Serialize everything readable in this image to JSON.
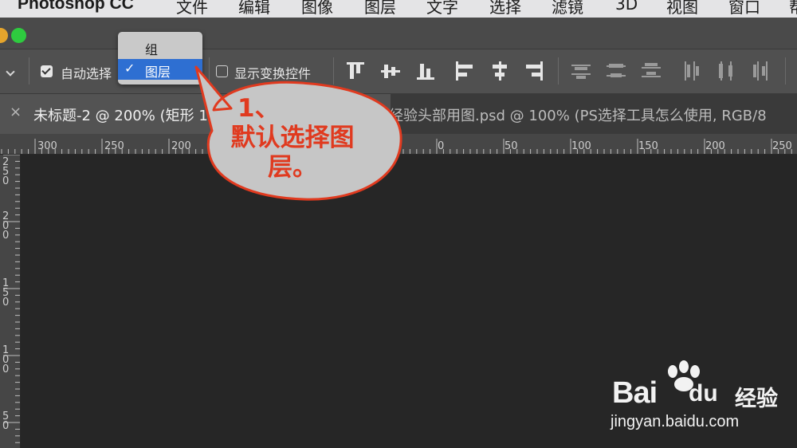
{
  "menubar": {
    "app_name": "Photoshop CC",
    "items": [
      "文件",
      "编辑",
      "图像",
      "图层",
      "文字",
      "选择",
      "滤镜",
      "3D",
      "视图",
      "窗口",
      "帮"
    ]
  },
  "options_bar": {
    "auto_select_label": "自动选择",
    "auto_select_checked": true,
    "show_transform_label": "显示变换控件",
    "show_transform_checked": false,
    "align_icons": [
      "align-top-edges-icon",
      "align-vertical-centers-icon",
      "align-bottom-edges-icon",
      "align-left-edges-icon",
      "align-horizontal-centers-icon",
      "align-right-edges-icon"
    ],
    "distribute_icons": [
      "distribute-top-icon",
      "distribute-vertical-centers-icon",
      "distribute-bottom-icon",
      "distribute-left-icon",
      "distribute-horizontal-centers-icon",
      "distribute-right-icon"
    ]
  },
  "dropdown": {
    "options": [
      "组",
      "图层"
    ],
    "selected": "图层",
    "check_mark": "✓"
  },
  "tabs": {
    "close_glyph": "×",
    "active": "未标题-2 @ 200% (矩形 1",
    "inactive": "经验头部用图.psd @ 100% (PS选择工具怎么使用, RGB/8"
  },
  "rulers": {
    "horizontal": [
      "300",
      "250",
      "200",
      "0",
      "50",
      "100",
      "150",
      "200",
      "250"
    ],
    "vertical": [
      "250",
      "200",
      "150",
      "100",
      "50"
    ]
  },
  "callout": {
    "line1": "1、",
    "line2": "默认选择图",
    "line3": "层。"
  },
  "watermark": {
    "bai": "Bai",
    "du": "du",
    "jingyan": "经验",
    "url": "jingyan.baidu.com"
  },
  "colors": {
    "callout_text": "#e03a1f",
    "callout_fill": "#c6c6c6",
    "selection_blue": "#2e6fd2",
    "canvas_bg": "#262626"
  }
}
